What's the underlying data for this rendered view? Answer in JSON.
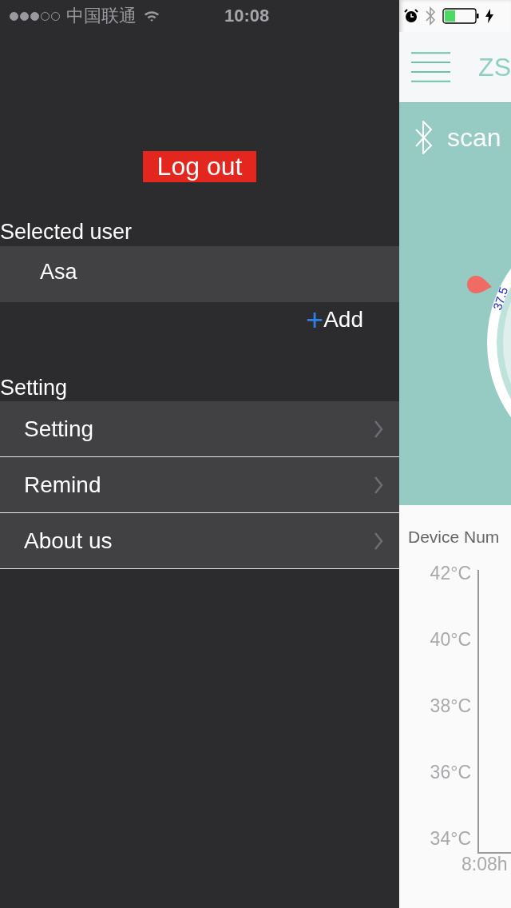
{
  "status_bar": {
    "signal_dots": [
      {
        "filled": true
      },
      {
        "filled": true
      },
      {
        "filled": true
      },
      {
        "filled": false
      },
      {
        "filled": false
      }
    ],
    "carrier": "中国联通",
    "time": "10:08"
  },
  "logout_button": {
    "label": "Log out"
  },
  "user_section": {
    "title": "Selected user",
    "users": [
      {
        "name": "Asa"
      }
    ],
    "add_button": {
      "icon": "+",
      "label": "Add"
    }
  },
  "setting_section": {
    "title": "Setting",
    "items": [
      {
        "label": "Setting"
      },
      {
        "label": "Remind"
      },
      {
        "label": "About us"
      }
    ]
  },
  "main_view": {
    "title": "ZS",
    "scan_label": "scan",
    "gauge_reading": "37.5",
    "device_label": "Device Num",
    "y_axis_labels": [
      "42°C",
      "40°C",
      "38°C",
      "36°C",
      "34°C"
    ],
    "x_axis_label": "8:08h"
  }
}
